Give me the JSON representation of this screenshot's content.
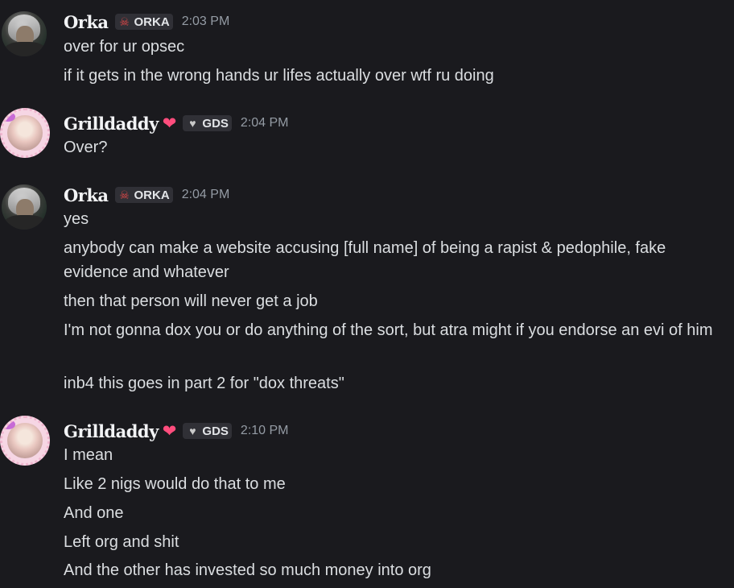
{
  "messages": [
    {
      "author": "Orka",
      "tag": {
        "icon": "skull-icon",
        "label": "ORKA"
      },
      "time": "2:03 PM",
      "lines": [
        "over for ur opsec",
        "if it gets in the wrong hands ur lifes actually over wtf ru doing"
      ]
    },
    {
      "author": "Grilldaddy",
      "author_emoji": "❤",
      "tag": {
        "icon": "heart-icon",
        "label": "GDS"
      },
      "time": "2:04 PM",
      "lines": [
        "Over?"
      ]
    },
    {
      "author": "Orka",
      "tag": {
        "icon": "skull-icon",
        "label": "ORKA"
      },
      "time": "2:04 PM",
      "lines": [
        "yes",
        "anybody can make a website accusing [full name] of being a rapist & pedophile, fake evidence and whatever",
        "then that person will never get a job",
        "I'm not gonna dox you or do anything of the sort, but atra might if you endorse an evi of him",
        "inb4 this goes in part 2 for \"dox threats\""
      ]
    },
    {
      "author": "Grilldaddy",
      "author_emoji": "❤",
      "tag": {
        "icon": "heart-icon",
        "label": "GDS"
      },
      "time": "2:10 PM",
      "lines": [
        "I mean",
        "Like 2 nigs would do that to me",
        "And one",
        "Left org and shit",
        "And the other has invested so much money into org"
      ]
    }
  ],
  "colors": {
    "background": "#1a1a1e",
    "text": "#dbdee1",
    "username": "#f2f3f5",
    "timestamp": "#949ba4",
    "tag_bg": "#303036",
    "heart": "#ff4d7d"
  }
}
